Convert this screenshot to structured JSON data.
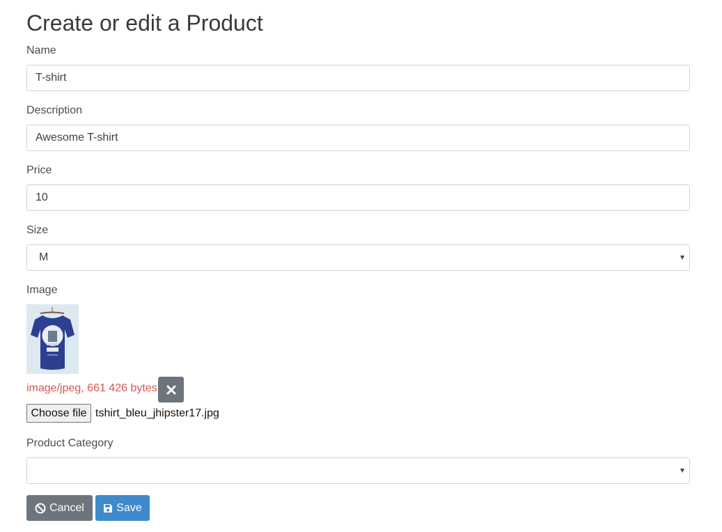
{
  "page": {
    "title": "Create or edit a Product"
  },
  "form": {
    "name": {
      "label": "Name",
      "value": "T-shirt"
    },
    "description": {
      "label": "Description",
      "value": "Awesome T-shirt"
    },
    "price": {
      "label": "Price",
      "value": "10"
    },
    "size": {
      "label": "Size",
      "selected": "M"
    },
    "image": {
      "label": "Image",
      "meta": "image/jpeg, 661 426 bytes",
      "choose_label": "Choose file",
      "file_name": "tshirt_bleu_jhipster17.jpg"
    },
    "category": {
      "label": "Product Category",
      "selected": ""
    }
  },
  "actions": {
    "cancel_label": "Cancel",
    "save_label": "Save"
  },
  "colors": {
    "primary": "#3e8acc",
    "secondary": "#6c757d",
    "danger": "#d9534f"
  },
  "icons": {
    "cancel": "ban-icon",
    "save": "floppy-disk-icon",
    "clear": "times-icon"
  }
}
